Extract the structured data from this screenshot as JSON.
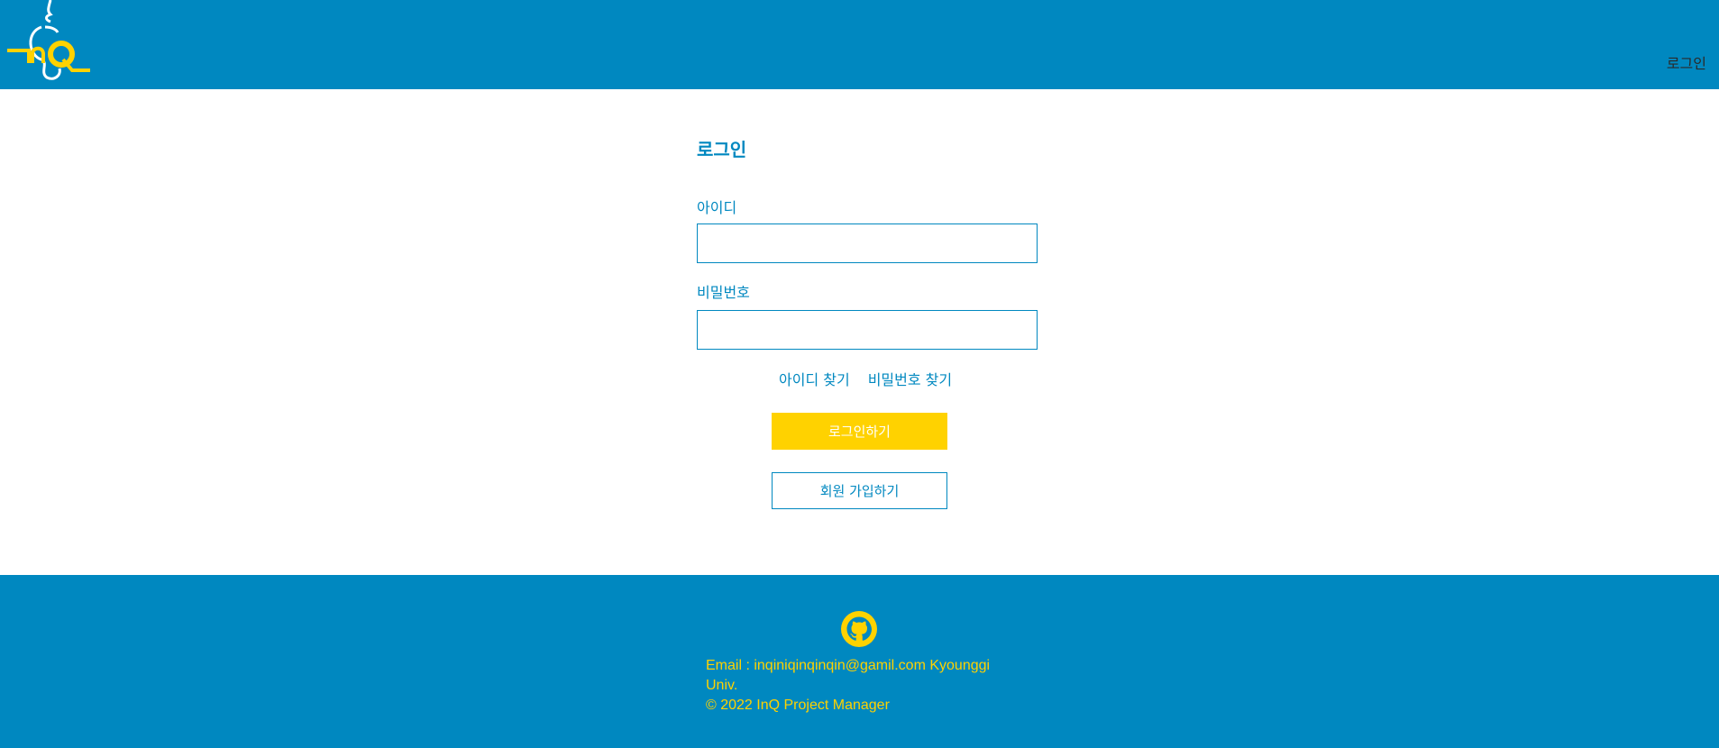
{
  "header": {
    "logo_text": "InQ",
    "login_link": "로그인"
  },
  "form": {
    "title": "로그인",
    "id_label": "아이디",
    "id_value": "",
    "password_label": "비밀번호",
    "password_value": "",
    "find_id": "아이디 찾기",
    "find_password": "비밀번호 찾기",
    "login_button": "로그인하기",
    "signup_button": "회원 가입하기"
  },
  "footer": {
    "icon": "github-icon",
    "email_line": "Email : inqiniqinqinqin@gamil.com Kyounggi Univ.",
    "copyright": "© 2022 InQ Project Manager"
  },
  "colors": {
    "brand_blue": "#0088c0",
    "accent_yellow": "#ffd200"
  }
}
